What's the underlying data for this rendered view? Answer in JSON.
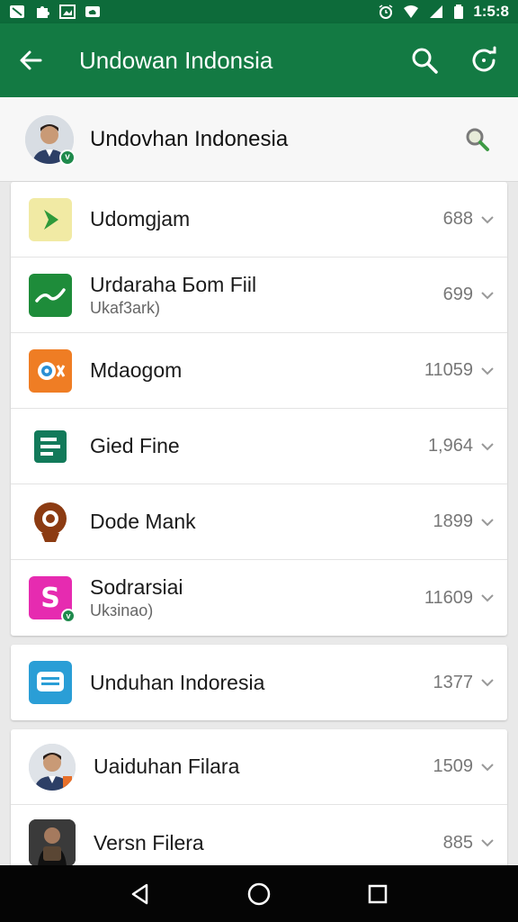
{
  "status_bar": {
    "time": "1:5:8",
    "left_icons": [
      "notification-icon",
      "puzzle-icon",
      "image-icon",
      "cloud-icon"
    ],
    "right_icons": [
      "alarm-icon",
      "wifi-icon",
      "signal-icon",
      "battery-icon"
    ]
  },
  "app_bar": {
    "title": "Undowan Indonsia",
    "back_icon": "arrow-left-icon",
    "actions": [
      "search-icon",
      "refresh-icon"
    ]
  },
  "header": {
    "name": "Undovhan Indonesia",
    "search_icon": "search-icon"
  },
  "colors": {
    "status_bar": "#0d6b3a",
    "app_bar": "#137a43",
    "accent": "#1f8a4c"
  },
  "list_group_1": [
    {
      "title": "Udomgjam",
      "subtitle": "",
      "count": "688",
      "icon": "play-arrow-icon",
      "icon_color": "#f1eaa4"
    },
    {
      "title": "Urdaraha Бom Fiil",
      "subtitle": "Ukaf3ark)",
      "count": "699",
      "icon": "wave-icon",
      "icon_color": "#1e8c3a"
    },
    {
      "title": "Mdaogom",
      "subtitle": "",
      "count": "11059",
      "icon": "camera-x-icon",
      "icon_color": "#ef7d24"
    },
    {
      "title": "Gied Fine",
      "subtitle": "",
      "count": "1,964",
      "icon": "document-icon",
      "icon_color": "#127a5a"
    },
    {
      "title": "Dode Mank",
      "subtitle": "",
      "count": "1899",
      "icon": "q-logo-icon",
      "icon_color": "#8c3b12"
    },
    {
      "title": "Sodrarsiai",
      "subtitle": "Ukзinao)",
      "count": "11609",
      "icon": "dollar-icon",
      "icon_color": "#e62bb0"
    }
  ],
  "list_group_2": [
    {
      "title": "Unduhan Indoresia",
      "subtitle": "",
      "count": "1377",
      "icon": "message-icon",
      "icon_color": "#2a9ed6"
    }
  ],
  "list_group_3": [
    {
      "title": "Uaiduhan Filara",
      "subtitle": "",
      "count": "1509",
      "icon": "person-photo-icon",
      "icon_color": "#c9d2db"
    },
    {
      "title": "Versn Filera",
      "subtitle": "",
      "count": "885",
      "icon": "person-dark-photo-icon",
      "icon_color": "#2b2b2b"
    }
  ],
  "nav_bar": {
    "buttons": [
      "back-triangle-icon",
      "home-circle-icon",
      "recents-square-icon"
    ]
  }
}
